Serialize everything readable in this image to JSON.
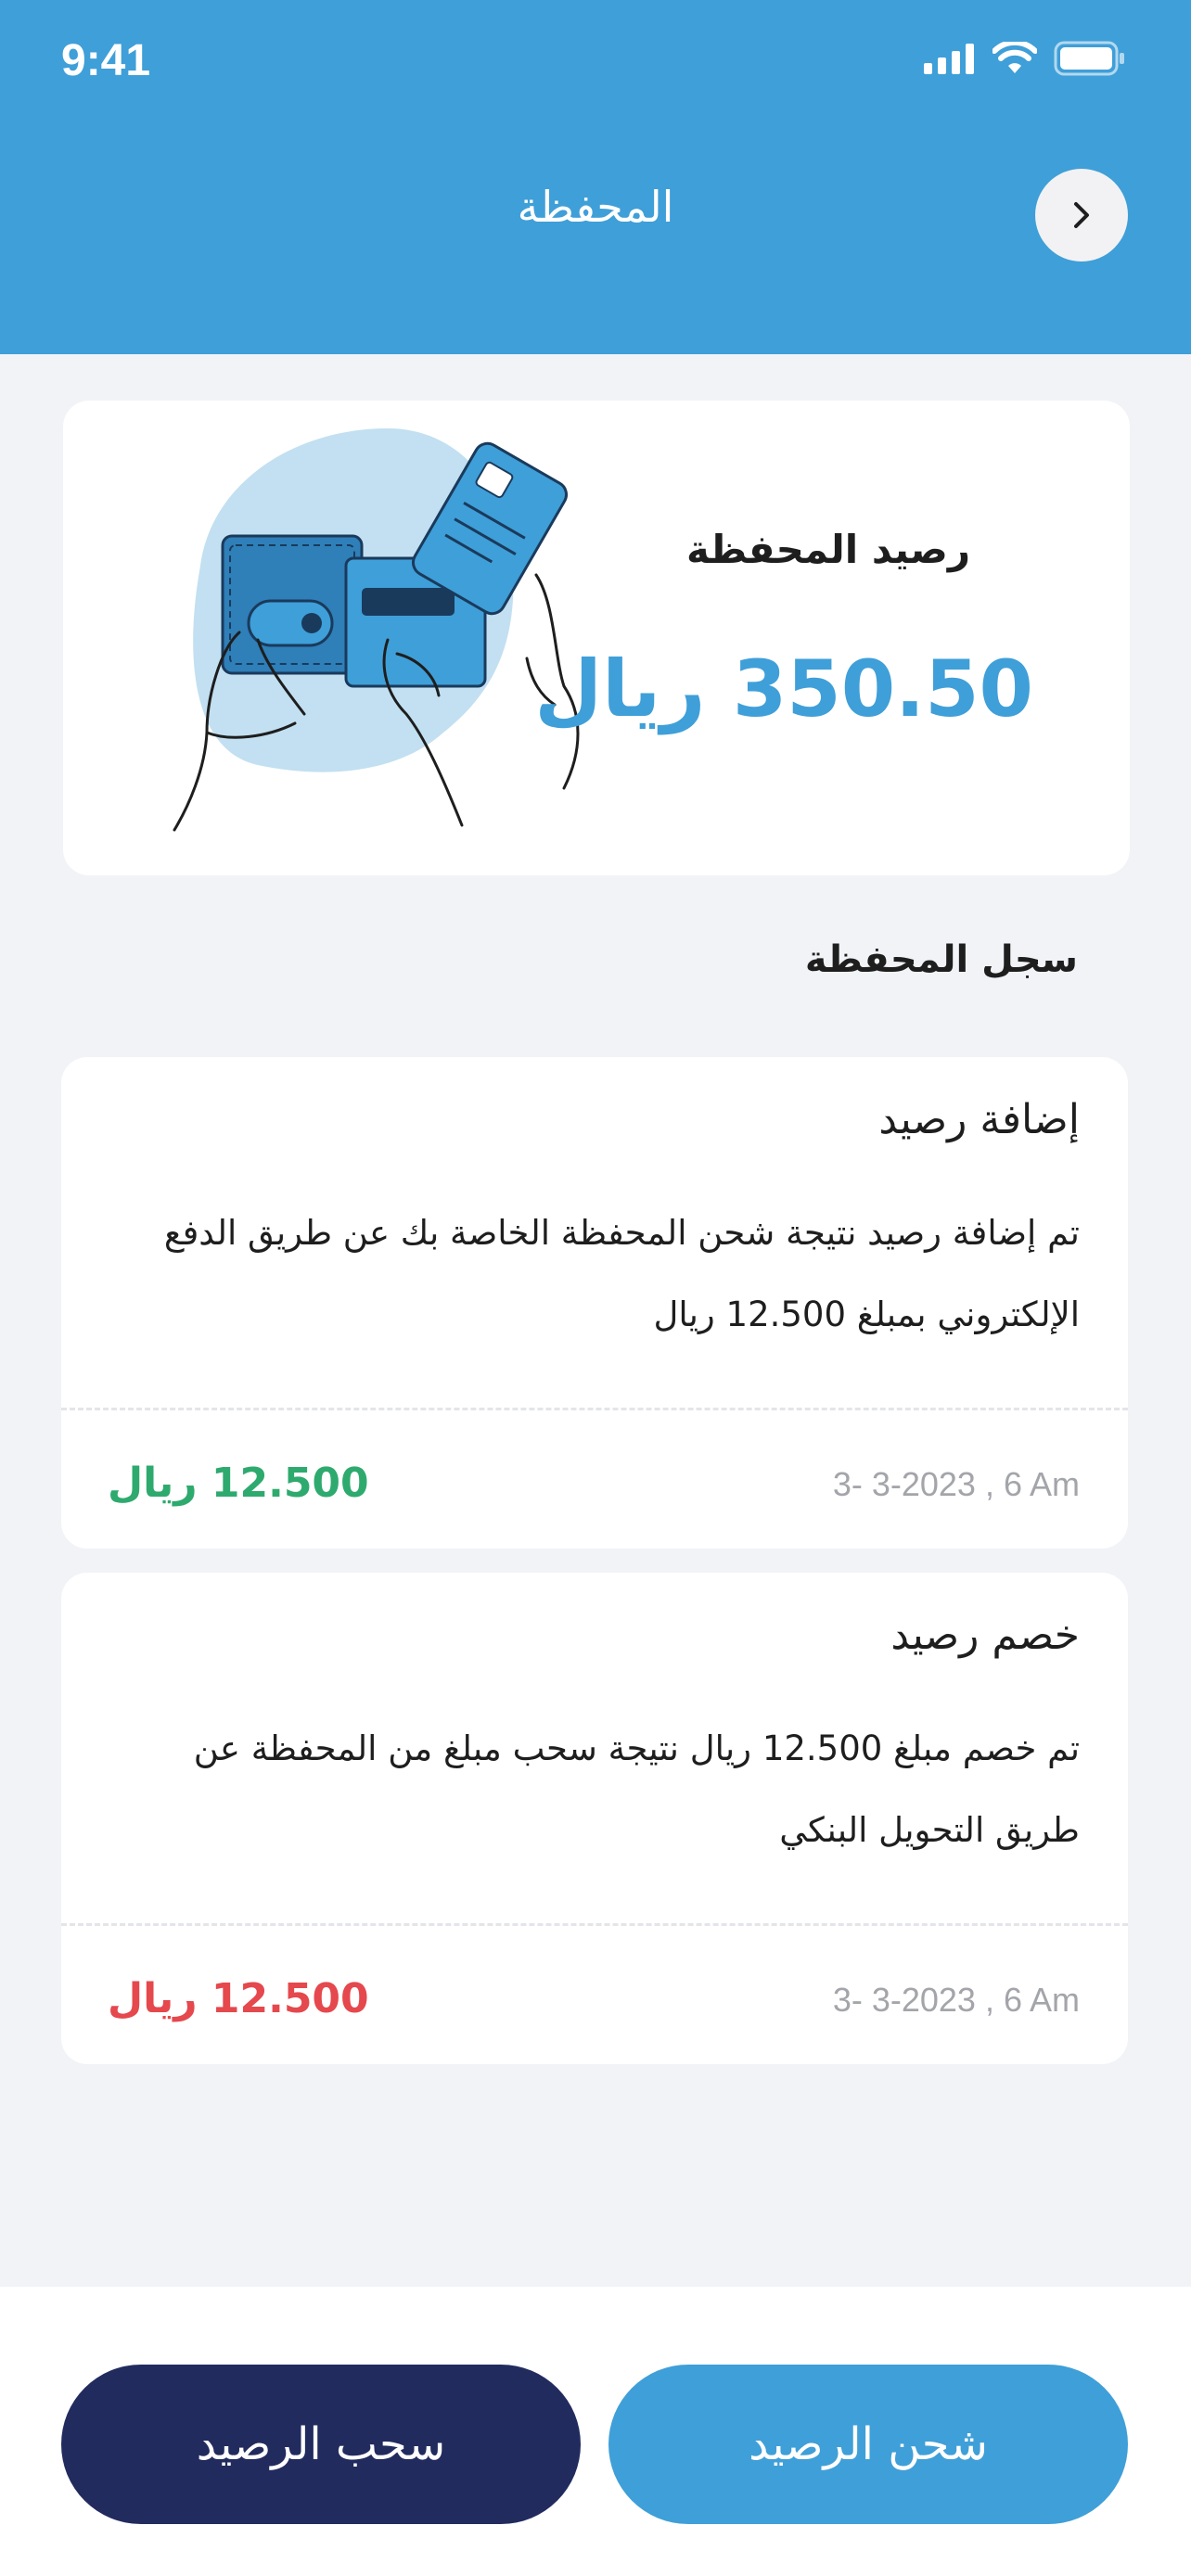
{
  "status_bar": {
    "time": "9:41"
  },
  "header": {
    "title": "المحفظة",
    "back_icon": "chevron-right-icon"
  },
  "balance": {
    "label": "رصيد المحفظة",
    "amount": "350.50 ريال"
  },
  "history": {
    "title": "سجل المحفظة",
    "transactions": [
      {
        "title": "إضافة رصيد",
        "description_line1": "تم إضافة رصيد نتيجة شحن المحفظة الخاصة بك عن طريق الدفع",
        "description_line2": "الإلكتروني بمبلغ 12.500 ريال",
        "date": "3- 3-2023 , 6 Am",
        "amount": "12.500 ريال",
        "amount_color": "#2EAA6E"
      },
      {
        "title": "خصم رصيد",
        "description_line1": "تم خصم مبلغ 12.500 ريال نتيجة سحب مبلغ من المحفظة عن",
        "description_line2": "طريق التحويل البنكي",
        "date": "3- 3-2023 , 6 Am",
        "amount": "12.500 ريال",
        "amount_color": "#E5484D"
      }
    ]
  },
  "actions": {
    "charge_label": "شحن الرصيد",
    "withdraw_label": "سحب الرصيد"
  },
  "colors": {
    "primary": "#3F9FD8",
    "dark": "#212B5E",
    "credit": "#2EAA6E",
    "debit": "#E5484D"
  }
}
